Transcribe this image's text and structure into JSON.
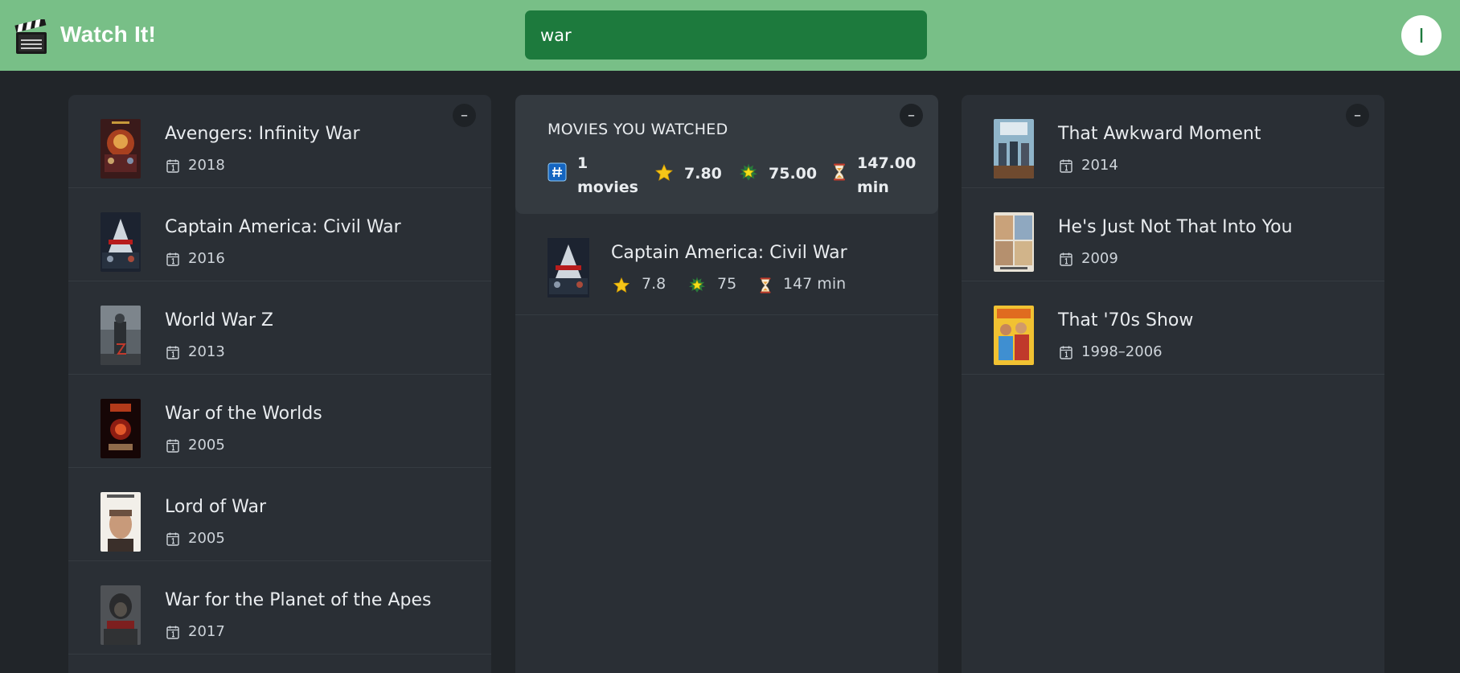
{
  "app": {
    "title": "Watch It!",
    "avatar_initial": "I"
  },
  "search": {
    "value": "war",
    "placeholder": ""
  },
  "results": [
    {
      "title": "Avengers: Infinity War",
      "year": "2018"
    },
    {
      "title": "Captain America: Civil War",
      "year": "2016"
    },
    {
      "title": "World War Z",
      "year": "2013"
    },
    {
      "title": "War of the Worlds",
      "year": "2005"
    },
    {
      "title": "Lord of War",
      "year": "2005"
    },
    {
      "title": "War for the Planet of the Apes",
      "year": "2017"
    }
  ],
  "watched": {
    "heading": "MOVIES YOU WATCHED",
    "stats": {
      "count_num": "1",
      "count_unit": "movies",
      "rating": "7.80",
      "score": "75.00",
      "runtime_num": "147.00",
      "runtime_unit": "min"
    },
    "movies": [
      {
        "title": "Captain America: Civil War",
        "rating": "7.8",
        "score": "75",
        "runtime": "147 min"
      }
    ]
  },
  "recommended": [
    {
      "title": "That Awkward Moment",
      "year": "2014"
    },
    {
      "title": "He's Just Not That Into You",
      "year": "2009"
    },
    {
      "title": "That '70s Show",
      "year": "1998–2006"
    }
  ],
  "controls": {
    "collapse_label": "–"
  },
  "icons": {
    "logo": "clapperboard-icon",
    "year": "calendar-icon",
    "count": "hash-icon",
    "rating": "star-icon",
    "score": "glowing-star-icon",
    "runtime": "hourglass-icon"
  },
  "colors": {
    "header": "#78bf87",
    "search_bg": "#1d7a3d",
    "page_bg": "#212529",
    "panel_bg": "#2a2f35",
    "stats_bg": "#343a40"
  }
}
